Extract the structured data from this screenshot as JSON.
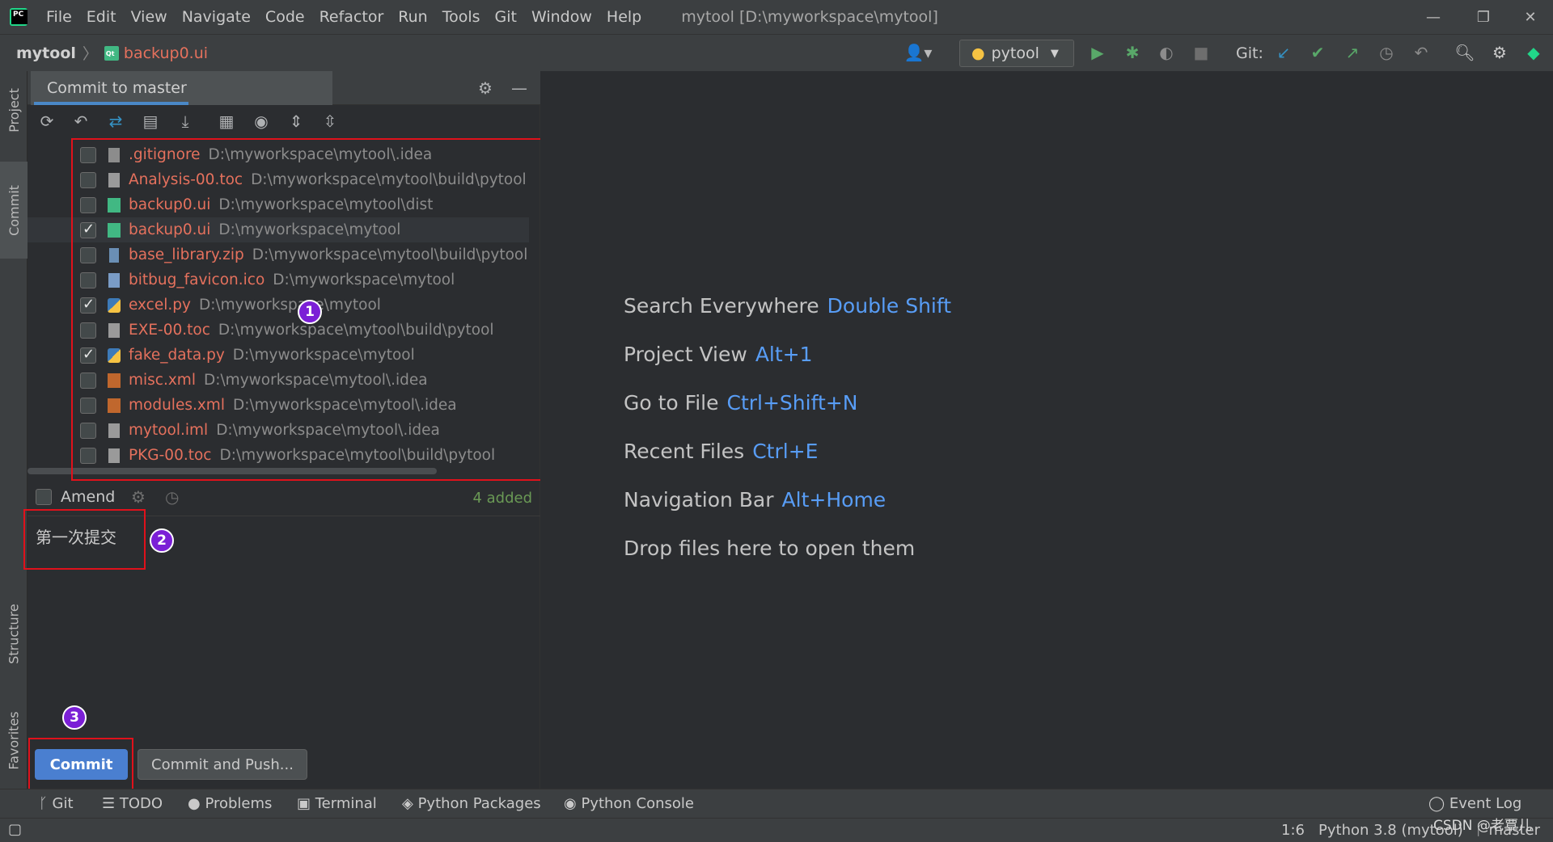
{
  "menubar": {
    "items": [
      "File",
      "Edit",
      "View",
      "Navigate",
      "Code",
      "Refactor",
      "Run",
      "Tools",
      "Git",
      "Window",
      "Help"
    ],
    "window_title": "mytool [D:\\myworkspace\\mytool]"
  },
  "navbar": {
    "project": "mytool",
    "file": "backup0.ui",
    "run_config": "pytool",
    "git_label": "Git:"
  },
  "left_strip": {
    "project": "Project",
    "commit": "Commit",
    "structure": "Structure",
    "favorites": "Favorites"
  },
  "commit_panel": {
    "tab_title": "Commit to master",
    "files": [
      {
        "name": ".gitignore",
        "path": "D:\\myworkspace\\mytool\\.idea",
        "checked": false
      },
      {
        "name": "Analysis-00.toc",
        "path": "D:\\myworkspace\\mytool\\build\\pytool",
        "checked": false
      },
      {
        "name": "backup0.ui",
        "path": "D:\\myworkspace\\mytool\\dist",
        "checked": false
      },
      {
        "name": "backup0.ui",
        "path": "D:\\myworkspace\\mytool",
        "checked": true
      },
      {
        "name": "base_library.zip",
        "path": "D:\\myworkspace\\mytool\\build\\pytool",
        "checked": false
      },
      {
        "name": "bitbug_favicon.ico",
        "path": "D:\\myworkspace\\mytool",
        "checked": false
      },
      {
        "name": "excel.py",
        "path": "D:\\myworkspace\\mytool",
        "checked": true
      },
      {
        "name": "EXE-00.toc",
        "path": "D:\\myworkspace\\mytool\\build\\pytool",
        "checked": false
      },
      {
        "name": "fake_data.py",
        "path": "D:\\myworkspace\\mytool",
        "checked": true
      },
      {
        "name": "misc.xml",
        "path": "D:\\myworkspace\\mytool\\.idea",
        "checked": false
      },
      {
        "name": "modules.xml",
        "path": "D:\\myworkspace\\mytool\\.idea",
        "checked": false
      },
      {
        "name": "mytool.iml",
        "path": "D:\\myworkspace\\mytool\\.idea",
        "checked": false
      },
      {
        "name": "PKG-00.toc",
        "path": "D:\\myworkspace\\mytool\\build\\pytool",
        "checked": false
      }
    ],
    "amend_label": "Amend",
    "added_count": "4 added",
    "commit_message": "第一次提交",
    "commit_button": "Commit",
    "commit_push_button": "Commit and Push...",
    "badges": [
      "1",
      "2",
      "3"
    ]
  },
  "welcome": {
    "hints": [
      {
        "label": "Search Everywhere",
        "key": "Double Shift"
      },
      {
        "label": "Project View",
        "key": "Alt+1"
      },
      {
        "label": "Go to File",
        "key": "Ctrl+Shift+N"
      },
      {
        "label": "Recent Files",
        "key": "Ctrl+E"
      },
      {
        "label": "Navigation Bar",
        "key": "Alt+Home"
      },
      {
        "label": "Drop files here to open them",
        "key": ""
      }
    ]
  },
  "bottom_bar": {
    "tabs": [
      "Git",
      "TODO",
      "Problems",
      "Terminal",
      "Python Packages",
      "Python Console"
    ],
    "event_log": "Event Log"
  },
  "status_bar": {
    "position": "1:6",
    "interpreter": "Python 3.8 (mytool)",
    "branch": "master",
    "watermark": "CSDN @老覃儿"
  }
}
